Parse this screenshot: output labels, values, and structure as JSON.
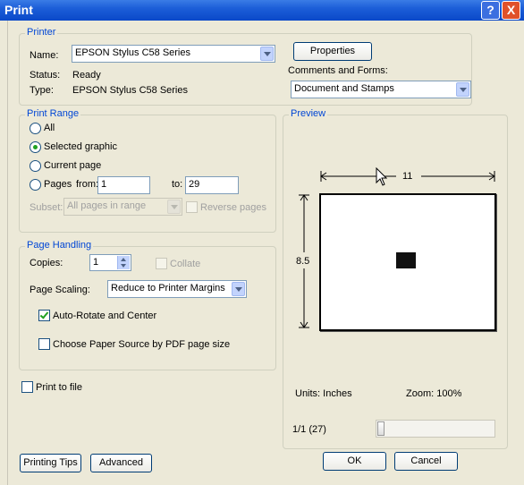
{
  "window": {
    "title": "Print",
    "help_label": "?",
    "close_label": "X"
  },
  "printer": {
    "group_title": "Printer",
    "name_label": "Name:",
    "name_value": "EPSON Stylus C58 Series",
    "status_label": "Status:",
    "status_value": "Ready",
    "type_label": "Type:",
    "type_value": "EPSON Stylus C58 Series",
    "properties_label": "Properties",
    "comments_label": "Comments and Forms:",
    "comments_value": "Document and Stamps"
  },
  "print_range": {
    "group_title": "Print Range",
    "all_label": "All",
    "selected_graphic_label": "Selected graphic",
    "current_page_label": "Current page",
    "pages_label": "Pages",
    "from_label": "from:",
    "from_value": "1",
    "to_label": "to:",
    "to_value": "29",
    "subset_label": "Subset:",
    "subset_value": "All pages in range",
    "reverse_label": "Reverse pages",
    "selected": "selected_graphic"
  },
  "page_handling": {
    "group_title": "Page Handling",
    "copies_label": "Copies:",
    "copies_value": "1",
    "collate_label": "Collate",
    "scaling_label": "Page Scaling:",
    "scaling_value": "Reduce to Printer Margins",
    "autorotate_label": "Auto-Rotate and Center",
    "autorotate_checked": true,
    "paper_source_label": "Choose Paper Source by PDF page size",
    "paper_source_checked": false
  },
  "print_to_file": {
    "label": "Print to file",
    "checked": false
  },
  "preview": {
    "group_title": "Preview",
    "width_label": "11",
    "height_label": "8.5",
    "units_label": "Units: Inches",
    "zoom_label": "Zoom: 100%",
    "page_counter": "1/1 (27)"
  },
  "buttons": {
    "printing_tips": "Printing Tips",
    "advanced": "Advanced",
    "ok": "OK",
    "cancel": "Cancel"
  },
  "colors": {
    "titlebar": "#0a48c8",
    "group_title": "#0046d5",
    "dialog_bg": "#ece9d8"
  }
}
